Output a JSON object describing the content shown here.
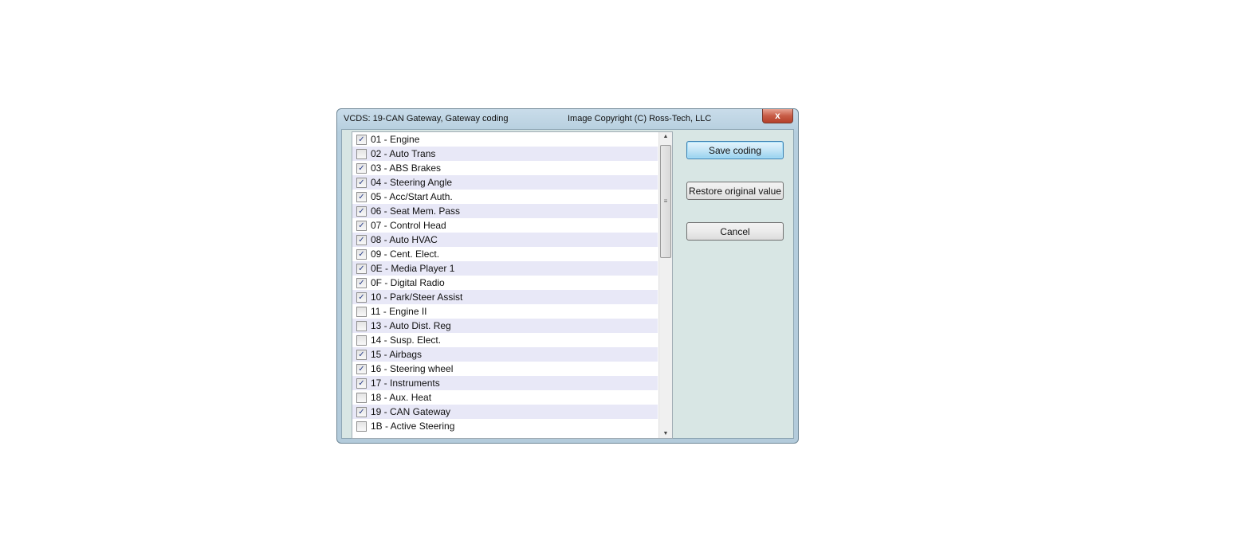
{
  "window": {
    "title": "VCDS: 19-CAN Gateway,  Gateway coding",
    "copyright": "Image Copyright (C) Ross-Tech, LLC",
    "close_label": "x"
  },
  "items": [
    {
      "label": "01 - Engine",
      "checked": true
    },
    {
      "label": "02 - Auto Trans",
      "checked": false
    },
    {
      "label": "03 - ABS Brakes",
      "checked": true
    },
    {
      "label": "04 - Steering Angle",
      "checked": true
    },
    {
      "label": "05 - Acc/Start Auth.",
      "checked": true
    },
    {
      "label": "06 - Seat Mem. Pass",
      "checked": true
    },
    {
      "label": "07 - Control Head",
      "checked": true
    },
    {
      "label": "08 - Auto HVAC",
      "checked": true
    },
    {
      "label": "09 - Cent. Elect.",
      "checked": true
    },
    {
      "label": "0E - Media Player 1",
      "checked": true
    },
    {
      "label": "0F - Digital Radio",
      "checked": true
    },
    {
      "label": "10 - Park/Steer Assist",
      "checked": true
    },
    {
      "label": "11 - Engine II",
      "checked": false
    },
    {
      "label": "13 - Auto Dist. Reg",
      "checked": false
    },
    {
      "label": "14 - Susp. Elect.",
      "checked": false
    },
    {
      "label": "15 - Airbags",
      "checked": true
    },
    {
      "label": "16 - Steering wheel",
      "checked": true
    },
    {
      "label": "17 - Instruments",
      "checked": true
    },
    {
      "label": "18 - Aux. Heat",
      "checked": false
    },
    {
      "label": "19 - CAN Gateway",
      "checked": true
    },
    {
      "label": "1B - Active Steering",
      "checked": false
    }
  ],
  "buttons": {
    "save": "Save coding",
    "restore": "Restore original value",
    "cancel": "Cancel"
  }
}
